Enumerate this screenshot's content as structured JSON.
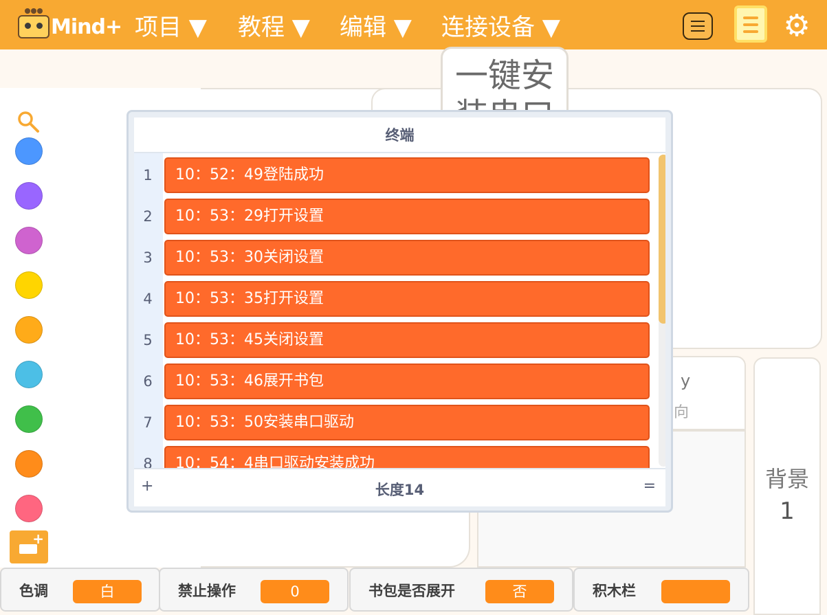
{
  "header": {
    "logo_text": "Mind+",
    "menus": [
      "项目 ▼",
      "教程 ▼",
      "编辑 ▼",
      "连接设备 ▼"
    ],
    "icons": [
      "menu-icon",
      "notebook-icon",
      "gear-icon"
    ],
    "gear_glyph": "⚙"
  },
  "install_button": {
    "label": "一键安装串口"
  },
  "sprite_info": {
    "y_label": "y",
    "direction_label": "向"
  },
  "backdrop": {
    "label": "背景",
    "count": "1"
  },
  "categories": {
    "colors": [
      "#4c97ff",
      "#9966ff",
      "#cf63cf",
      "#ffd500",
      "#ffab19",
      "#4cbfe6",
      "#40bf4a",
      "#ff8c1a",
      "#ff6680"
    ],
    "extension_plus": "+"
  },
  "terminal": {
    "title": "终端",
    "rows": [
      {
        "index": "1",
        "value": "10：52：49登陆成功"
      },
      {
        "index": "2",
        "value": "10：53：29打开设置"
      },
      {
        "index": "3",
        "value": "10：53：30关闭设置"
      },
      {
        "index": "4",
        "value": "10：53：35打开设置"
      },
      {
        "index": "5",
        "value": "10：53：45关闭设置"
      },
      {
        "index": "6",
        "value": "10：53：46展开书包"
      },
      {
        "index": "7",
        "value": "10：53：50安装串口驱动"
      },
      {
        "index": "8",
        "value": "10：54：4串口驱动安装成功"
      }
    ],
    "add_label": "+",
    "length_label": "长度14",
    "resize_label": "="
  },
  "monitors": [
    {
      "label": "色调",
      "value": "白"
    },
    {
      "label": "禁止操作",
      "value": "0"
    },
    {
      "label": "书包是否展开",
      "value": "否"
    },
    {
      "label": "积木栏",
      "value": ""
    }
  ],
  "colors": {
    "brand": "#f8a932",
    "list_item": "#ff6a2b",
    "monitor_value": "#ff8c1a"
  }
}
